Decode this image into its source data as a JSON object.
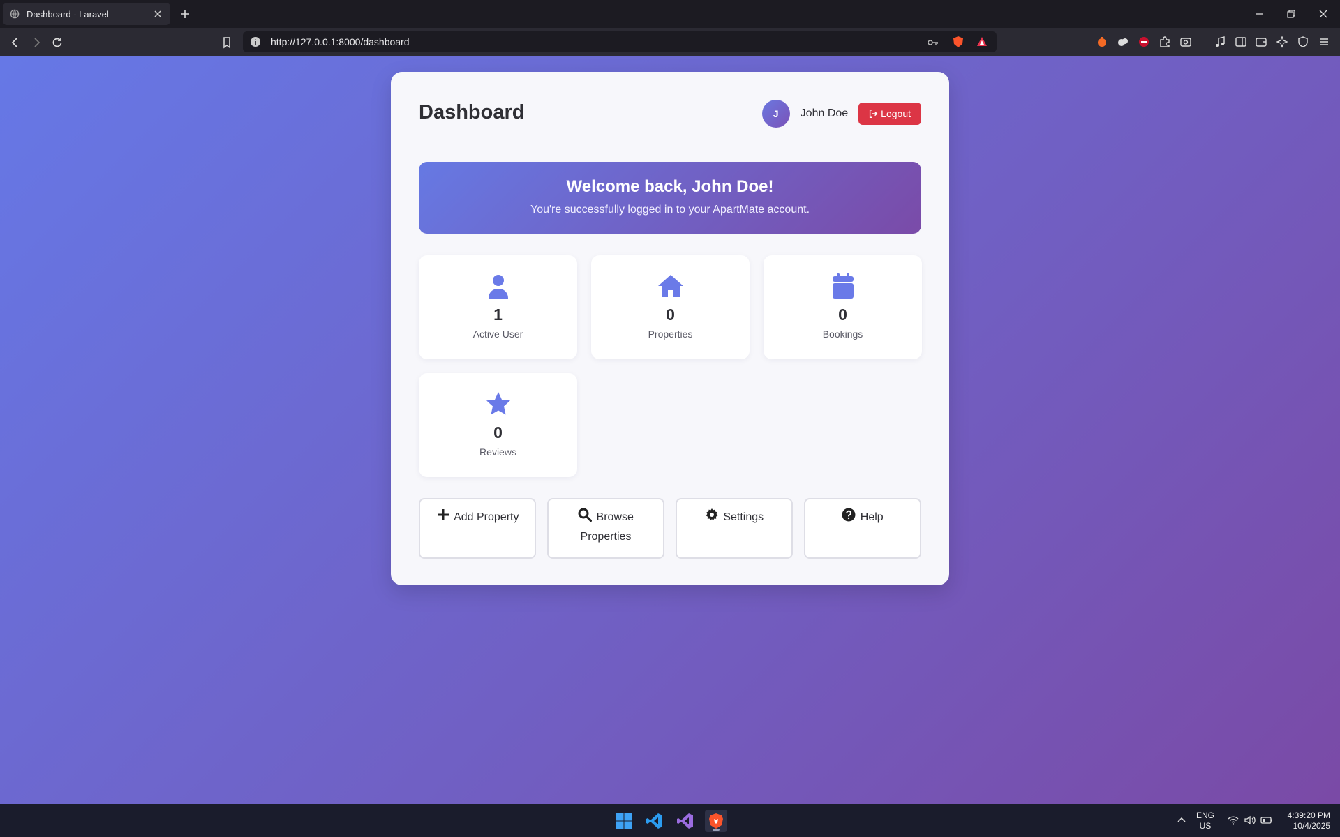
{
  "browser": {
    "tab_title": "Dashboard - Laravel",
    "url": "http://127.0.0.1:8000/dashboard"
  },
  "header": {
    "title": "Dashboard",
    "avatar_initial": "J",
    "user_name": "John Doe",
    "logout_label": "Logout"
  },
  "welcome": {
    "title": "Welcome back, John Doe!",
    "subtitle": "You're successfully logged in to your ApartMate account."
  },
  "stats": [
    {
      "icon": "user-icon",
      "value": "1",
      "label": "Active User"
    },
    {
      "icon": "home-icon",
      "value": "0",
      "label": "Properties"
    },
    {
      "icon": "calendar-icon",
      "value": "0",
      "label": "Bookings"
    },
    {
      "icon": "star-icon",
      "value": "0",
      "label": "Reviews"
    }
  ],
  "actions": [
    {
      "icon": "plus-icon",
      "label": "Add Property"
    },
    {
      "icon": "search-icon",
      "label": "Browse Properties"
    },
    {
      "icon": "gear-icon",
      "label": "Settings"
    },
    {
      "icon": "help-icon",
      "label": "Help"
    }
  ],
  "taskbar": {
    "lang_1": "ENG",
    "lang_2": "US",
    "time": "4:39:20 PM",
    "date": "10/4/2025"
  },
  "colors": {
    "accent": "#6a7ae8",
    "logout": "#dc3545",
    "gradient_start": "#6678e6",
    "gradient_end": "#7a4aa6"
  }
}
